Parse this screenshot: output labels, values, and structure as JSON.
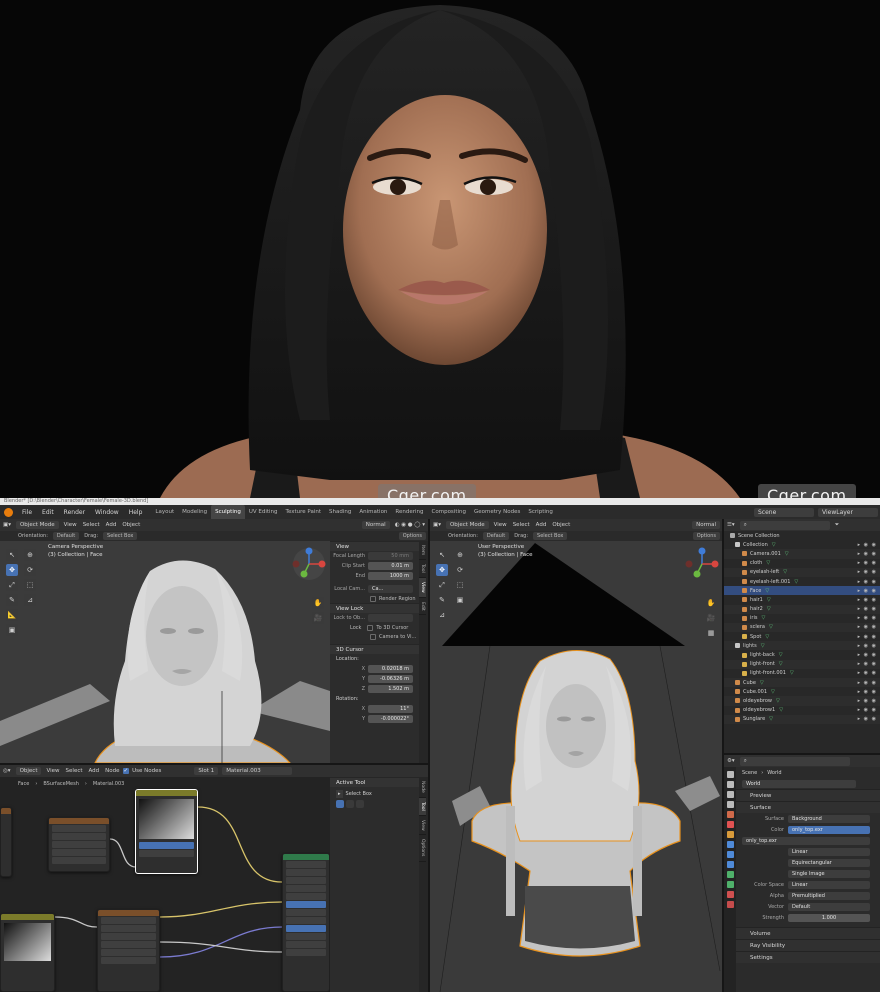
{
  "watermarks": [
    "Cger.com",
    "Cger.com"
  ],
  "titlebar": "Blender* [D:\\Blender\\Character\\Female\\Female-3D.blend]",
  "menu": [
    "File",
    "Edit",
    "Render",
    "Window",
    "Help"
  ],
  "workspaces": [
    "Layout",
    "Modeling",
    "Sculpting",
    "UV Editing",
    "Texture Paint",
    "Shading",
    "Animation",
    "Rendering",
    "Compositing",
    "Geometry Nodes",
    "Scripting"
  ],
  "active_workspace": "Sculpting",
  "scene_label": "Scene",
  "view_layer_label": "ViewLayer",
  "vp1": {
    "mode": "Object Mode",
    "menus": [
      "View",
      "Select",
      "Add",
      "Object"
    ],
    "shading": "Normal",
    "orientation_label": "Orientation:",
    "orientation_value": "Default",
    "drag_label": "Drag:",
    "drag_value": "Select Box",
    "options": "Options",
    "title": "Camera Perspective",
    "subtitle": "(3) Collection | Face"
  },
  "npanel": {
    "view_header": "View",
    "focal_label": "Focal Length",
    "focal_value": "50 mm",
    "clip_start_label": "Clip Start",
    "clip_start_value": "0.01 m",
    "end_label": "End",
    "end_value": "1000 m",
    "local_cam_label": "Local Cam...",
    "local_cam_value": "Ca...",
    "render_region": "Render Region",
    "view_lock_header": "View Lock",
    "lock_to_obj_label": "Lock to Ob...",
    "lock_label": "Lock",
    "to_3d_cursor": "To 3D Cursor",
    "camera_to_view": "Camera to Vi...",
    "cursor_header": "3D Cursor",
    "location_label": "Location:",
    "x_label": "X",
    "x_value": "0.02018 m",
    "y_label": "Y",
    "y_value": "-0.06326 m",
    "z_label": "Z",
    "z_value": "1.502 m",
    "rotation_label": "Rotation:",
    "rx_value": "11°",
    "ry_value": "-0.000022°",
    "tabs": [
      "Item",
      "Tool",
      "View",
      "Edit"
    ]
  },
  "vp2": {
    "mode": "Object Mode",
    "menus": [
      "View",
      "Select",
      "Add",
      "Object"
    ],
    "shading": "Normal",
    "orientation_label": "Orientation:",
    "orientation_value": "Default",
    "drag_label": "Drag:",
    "drag_value": "Select Box",
    "options": "Options",
    "title": "User Perspective",
    "subtitle": "(3) Collection | Face"
  },
  "node_editor": {
    "type": "Object",
    "menus": [
      "View",
      "Select",
      "Add",
      "Node"
    ],
    "use_nodes": "Use Nodes",
    "slot": "Slot 1",
    "material": "Material.003",
    "breadcrumbs": [
      "Face",
      "BSurfaceMesh",
      "Material.003"
    ],
    "active_tool_header": "Active Tool",
    "select_box": "Select Box",
    "tabs": [
      "Node",
      "Tool",
      "View",
      "Options"
    ]
  },
  "outliner": {
    "root": "Scene Collection",
    "items": [
      {
        "name": "Collection",
        "indent": 1,
        "color": "#c8c8c8"
      },
      {
        "name": "Camera.001",
        "indent": 2,
        "color": "#d08a4a"
      },
      {
        "name": "cloth",
        "indent": 2,
        "color": "#d08a4a"
      },
      {
        "name": "eyelash-left",
        "indent": 2,
        "color": "#d08a4a"
      },
      {
        "name": "eyelash-left.001",
        "indent": 2,
        "color": "#d08a4a"
      },
      {
        "name": "Face",
        "indent": 2,
        "color": "#d08a4a",
        "selected": true
      },
      {
        "name": "hair1",
        "indent": 2,
        "color": "#d08a4a"
      },
      {
        "name": "hair2",
        "indent": 2,
        "color": "#d08a4a"
      },
      {
        "name": "iris",
        "indent": 2,
        "color": "#d08a4a"
      },
      {
        "name": "sclera",
        "indent": 2,
        "color": "#d08a4a"
      },
      {
        "name": "Spot",
        "indent": 2,
        "color": "#d8b04a"
      },
      {
        "name": "lights",
        "indent": 1,
        "color": "#c8c8c8"
      },
      {
        "name": "light-back",
        "indent": 2,
        "color": "#d8b04a"
      },
      {
        "name": "light-front",
        "indent": 2,
        "color": "#d8b04a"
      },
      {
        "name": "light-front.001",
        "indent": 2,
        "color": "#d8b04a"
      },
      {
        "name": "Cube",
        "indent": 1,
        "color": "#d08a4a"
      },
      {
        "name": "Cube.001",
        "indent": 1,
        "color": "#d08a4a"
      },
      {
        "name": "oldeyebrow",
        "indent": 1,
        "color": "#d08a4a"
      },
      {
        "name": "oldeyebrow1",
        "indent": 1,
        "color": "#d08a4a"
      },
      {
        "name": "Sunglare",
        "indent": 1,
        "color": "#d08a4a"
      }
    ]
  },
  "properties": {
    "scene": "Scene",
    "world": "World",
    "world_name": "World",
    "preview": "Preview",
    "surface_section": "Surface",
    "surface_label": "Surface",
    "surface_value": "Background",
    "color_label": "Color",
    "color_value": "only_top.exr",
    "image_name": "only_top.exr",
    "interp": "Linear",
    "projection": "Equirectangular",
    "source": "Single Image",
    "color_space_label": "Color Space",
    "color_space_value": "Linear",
    "alpha_label": "Alpha",
    "alpha_value": "Premultiplied",
    "vector_label": "Vector",
    "vector_value": "Default",
    "strength_label": "Strength",
    "strength_value": "1.000",
    "volume": "Volume",
    "ray_visibility": "Ray Visibility",
    "settings": "Settings"
  },
  "colors": {
    "accent_blue": "#4772b3",
    "selection_orange": "#e8921e",
    "blender_orange": "#e87d0d"
  }
}
